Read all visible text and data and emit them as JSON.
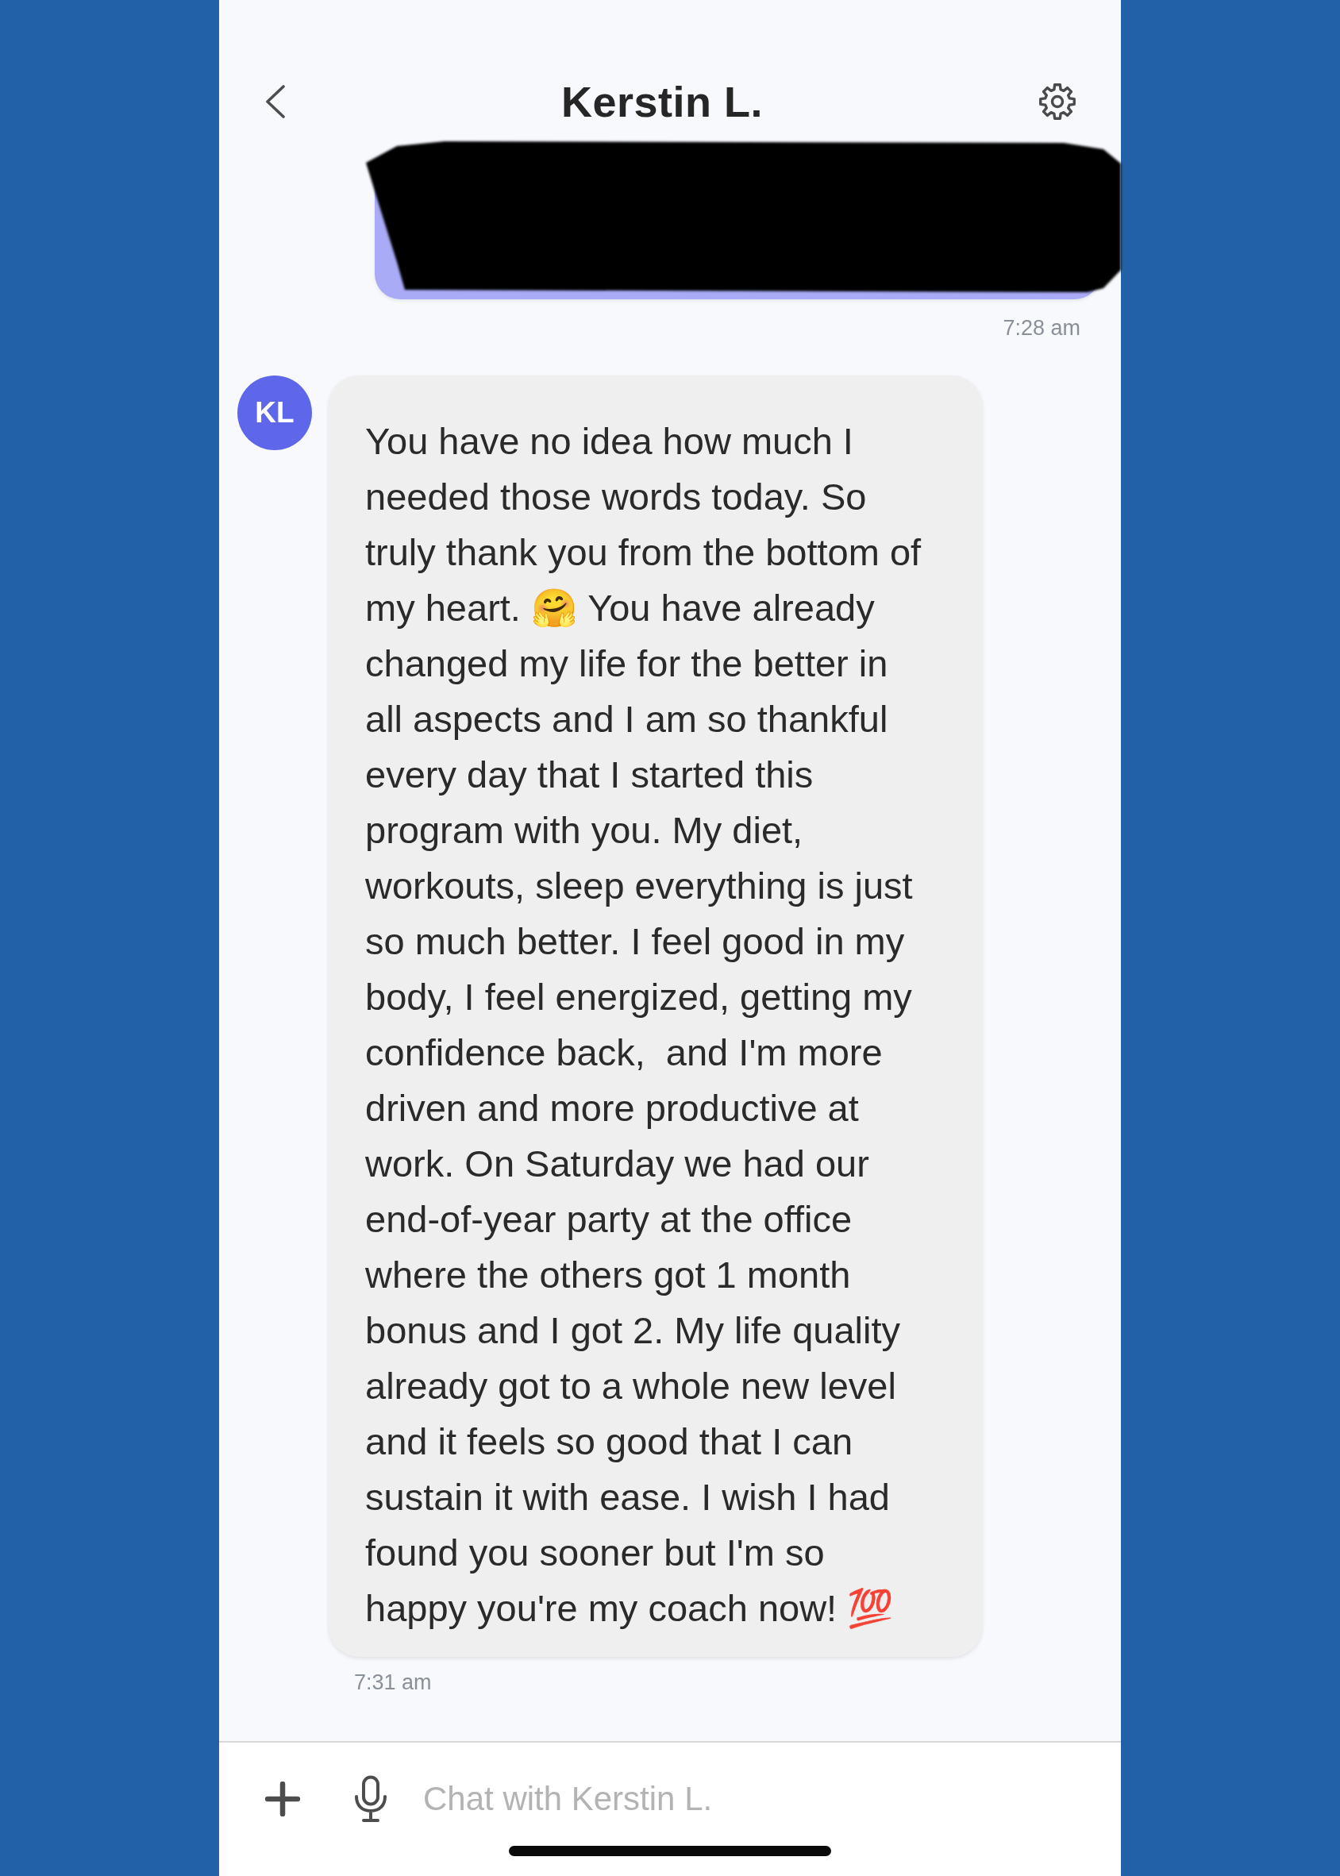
{
  "header": {
    "title": "Kerstin L."
  },
  "messages": [
    {
      "kind": "sent",
      "redacted": true,
      "time": "7:28 am"
    },
    {
      "kind": "received",
      "avatar": "KL",
      "text": "You have no idea how much I needed those words today. So truly thank you from the bottom of my heart. 🤗 You have already changed my life for the better in all aspects and I am so thankful every day that I started this program with you. My diet, workouts, sleep everything is just so much better. I feel good in my body, I feel energized, getting my confidence back,  and I'm more driven and more productive at work. On Saturday we had our end-of-year party at the office where the others got 1 month bonus and I got 2. My life quality already got to a whole new level and it feels so good that I can sustain it with ease. I wish I had found you sooner but I'm so happy you're my coach now! 💯",
      "time": "7:31 am"
    }
  ],
  "composer": {
    "placeholder": "Chat with Kerstin L."
  }
}
